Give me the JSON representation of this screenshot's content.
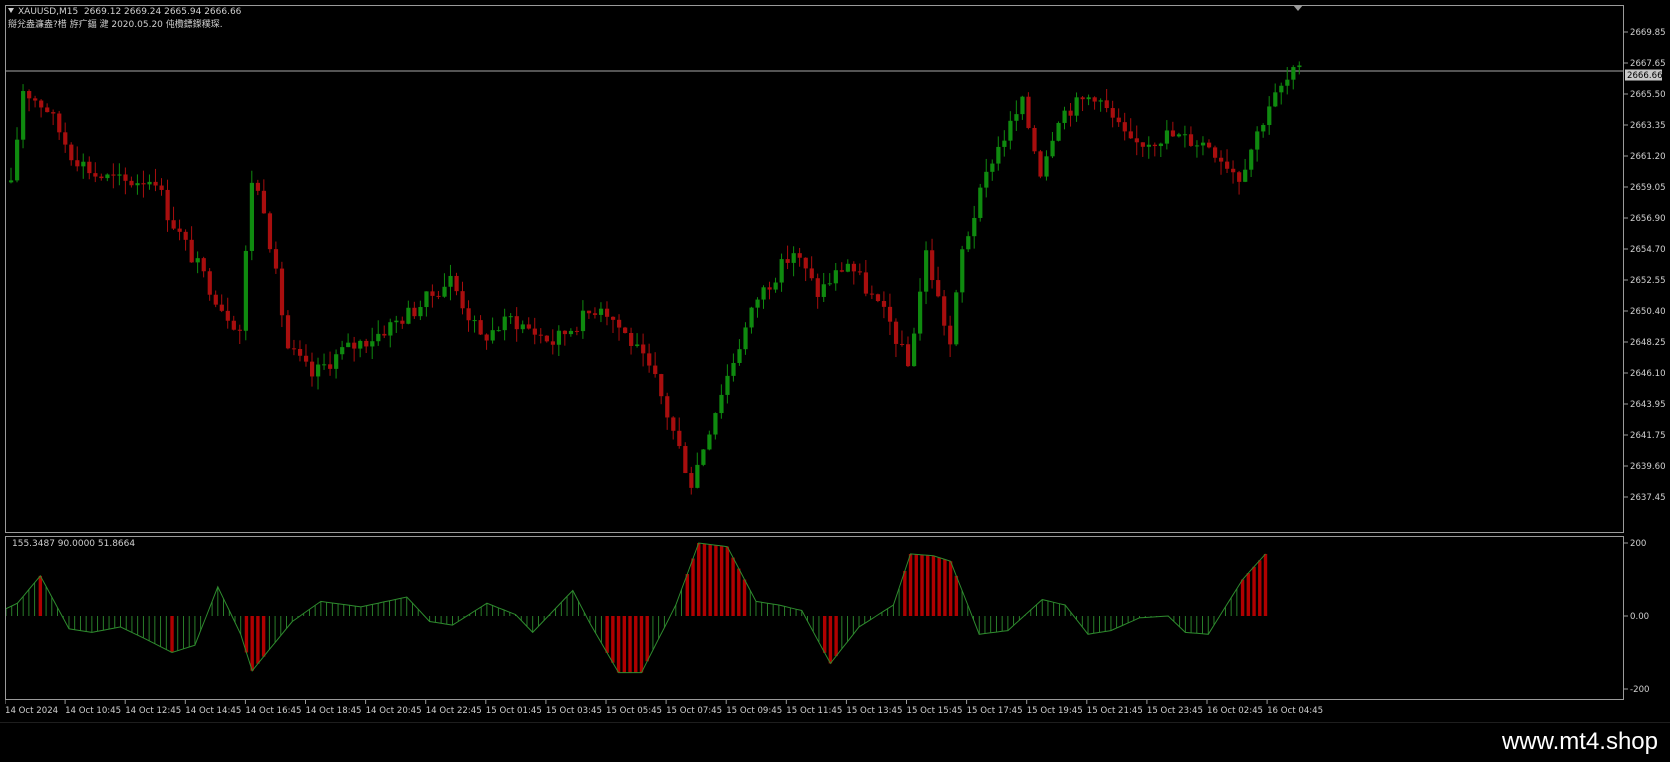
{
  "header": {
    "symbol": "XAUUSD,M15",
    "ohlc": "2669.12 2669.24 2665.94 2666.66",
    "comment": "搿兊盎濂盎?棤 斿疒鍢 湕 2020.05.20 伅欖鏢鏫穙琛."
  },
  "price_axis": {
    "labels": [
      "2669.85",
      "2667.65",
      "2665.50",
      "2663.35",
      "2661.20",
      "2659.05",
      "2656.90",
      "2654.70",
      "2652.55",
      "2650.40",
      "2648.25",
      "2646.10",
      "2643.95",
      "2641.75",
      "2639.60",
      "2637.45"
    ],
    "current_price": "2666.66"
  },
  "oscillator": {
    "values_text": "155.3487 90.0000 51.8664",
    "axis_labels": [
      "200",
      "0.00",
      "-200"
    ]
  },
  "time_axis": {
    "labels": [
      "14 Oct 2024",
      "14 Oct 10:45",
      "14 Oct 12:45",
      "14 Oct 14:45",
      "14 Oct 16:45",
      "14 Oct 18:45",
      "14 Oct 20:45",
      "14 Oct 22:45",
      "15 Oct 01:45",
      "15 Oct 03:45",
      "15 Oct 05:45",
      "15 Oct 07:45",
      "15 Oct 09:45",
      "15 Oct 11:45",
      "15 Oct 13:45",
      "15 Oct 15:45",
      "15 Oct 17:45",
      "15 Oct 19:45",
      "15 Oct 21:45",
      "15 Oct 23:45",
      "16 Oct 02:45",
      "16 Oct 04:45"
    ]
  },
  "watermark": "www.mt4.shop",
  "colors": {
    "bull": "#0f8a0f",
    "bear": "#a80e0e",
    "osc_line": "#2e8b2e",
    "osc_extreme": "#b00000",
    "grid_text": "#cfcfcf",
    "border": "#9a9a9a"
  },
  "chart_data": [
    {
      "type": "candlestick",
      "symbol": "XAUUSD",
      "timeframe": "M15",
      "ylim": [
        2637.45,
        2671.0
      ],
      "close_path": [
        [
          0,
          2659.1
        ],
        [
          2,
          2665.5
        ],
        [
          6,
          2664.2
        ],
        [
          10,
          2661.3
        ],
        [
          14,
          2659.9
        ],
        [
          19,
          2659.4
        ],
        [
          24,
          2659.7
        ],
        [
          26,
          2657.4
        ],
        [
          30,
          2654.6
        ],
        [
          35,
          2651.3
        ],
        [
          38,
          2649.8
        ],
        [
          40,
          2659.6
        ],
        [
          42,
          2657.9
        ],
        [
          46,
          2648.6
        ],
        [
          50,
          2646.8
        ],
        [
          55,
          2648.4
        ],
        [
          60,
          2649.3
        ],
        [
          67,
          2651.1
        ],
        [
          73,
          2653.1
        ],
        [
          78,
          2649.2
        ],
        [
          83,
          2650.5
        ],
        [
          90,
          2649.0
        ],
        [
          98,
          2651.5
        ],
        [
          103,
          2649.0
        ],
        [
          107,
          2646.5
        ],
        [
          113,
          2639.8
        ],
        [
          118,
          2645.8
        ],
        [
          124,
          2651.9
        ],
        [
          130,
          2654.9
        ],
        [
          134,
          2652.2
        ],
        [
          139,
          2654.2
        ],
        [
          146,
          2650.2
        ],
        [
          149,
          2647.4
        ],
        [
          152,
          2654.8
        ],
        [
          156,
          2648.8
        ],
        [
          158,
          2654.9
        ],
        [
          163,
          2661.0
        ],
        [
          168,
          2664.5
        ],
        [
          171,
          2660.2
        ],
        [
          174,
          2663.8
        ],
        [
          180,
          2665.2
        ],
        [
          186,
          2661.8
        ],
        [
          192,
          2662.5
        ],
        [
          199,
          2661.9
        ],
        [
          204,
          2659.8
        ],
        [
          209,
          2664.5
        ],
        [
          213,
          2666.5
        ]
      ]
    },
    {
      "type": "bar",
      "name": "oscillator",
      "ylim": [
        -200,
        200
      ],
      "values_text": [
        155.3487,
        90.0,
        51.8664
      ],
      "path": [
        [
          0,
          20
        ],
        [
          2,
          35
        ],
        [
          6,
          110
        ],
        [
          11,
          -35
        ],
        [
          15,
          -45
        ],
        [
          20,
          -30
        ],
        [
          24,
          -60
        ],
        [
          29,
          -100
        ],
        [
          33,
          -80
        ],
        [
          37,
          80
        ],
        [
          41,
          -50
        ],
        [
          43,
          -150
        ],
        [
          50,
          -15
        ],
        [
          55,
          40
        ],
        [
          62,
          25
        ],
        [
          70,
          52
        ],
        [
          74,
          -15
        ],
        [
          78,
          -25
        ],
        [
          84,
          35
        ],
        [
          89,
          4
        ],
        [
          92,
          -45
        ],
        [
          99,
          70
        ],
        [
          102,
          -20
        ],
        [
          107,
          -155
        ],
        [
          111,
          -155
        ],
        [
          117,
          30
        ],
        [
          121,
          200
        ],
        [
          126,
          190
        ],
        [
          131,
          40
        ],
        [
          135,
          30
        ],
        [
          139,
          15
        ],
        [
          144,
          -130
        ],
        [
          149,
          -30
        ],
        [
          155,
          30
        ],
        [
          158,
          170
        ],
        [
          162,
          165
        ],
        [
          165,
          150
        ],
        [
          170,
          -50
        ],
        [
          175,
          -40
        ],
        [
          181,
          45
        ],
        [
          185,
          30
        ],
        [
          189,
          -50
        ],
        [
          193,
          -40
        ],
        [
          198,
          -5
        ],
        [
          203,
          0
        ],
        [
          206,
          -45
        ],
        [
          210,
          -50
        ],
        [
          216,
          100
        ],
        [
          220,
          170
        ]
      ]
    }
  ]
}
